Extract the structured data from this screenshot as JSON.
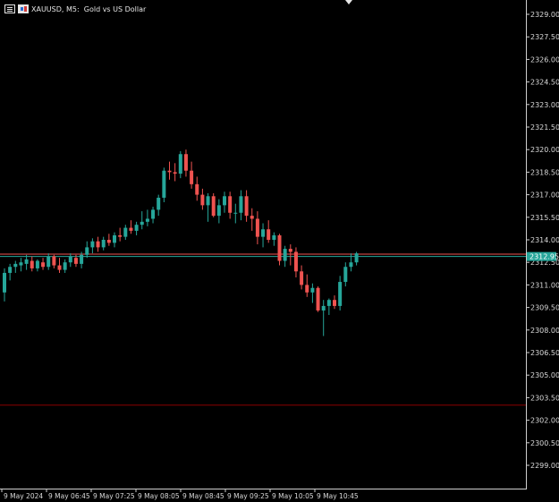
{
  "header": {
    "title": "XAUUSD, M5:  Gold vs US Dollar",
    "menu_icon": "chart-menu-icon",
    "symbol_icon": "symbol-icon"
  },
  "colors": {
    "background": "#000000",
    "bull": "#26a69a",
    "bear": "#ef5350",
    "axis": "#cfcfcf",
    "bid_line": "#26a69a",
    "ask_line": "#ef5350",
    "level_line": "#8b0000",
    "price_tag_bg": "#26a69a"
  },
  "price_scale": {
    "labels": [
      "2329.00",
      "2327.50",
      "2326.00",
      "2324.50",
      "2323.00",
      "2321.50",
      "2320.00",
      "2318.50",
      "2317.00",
      "2315.50",
      "2314.00",
      "2312.50",
      "2311.00",
      "2309.50",
      "2308.00",
      "2306.50",
      "2305.00",
      "2303.50",
      "2302.00",
      "2300.50",
      "2299.00"
    ],
    "current_price": "2312.95"
  },
  "time_scale": {
    "labels": [
      "9 May 2024",
      "9 May 06:45",
      "9 May 07:25",
      "9 May 08:05",
      "9 May 08:45",
      "9 May 09:25",
      "9 May 10:05",
      "9 May 10:45"
    ]
  },
  "levels": {
    "bid": 2312.95,
    "ask": 2313.05,
    "horizontal_line": 2303.0
  },
  "chart_data": {
    "type": "candlestick",
    "symbol": "XAUUSD",
    "timeframe": "M5",
    "ylim": [
      2298.2,
      2329.5
    ],
    "candles": [
      [
        2310.5,
        2312.1,
        2309.9,
        2311.8
      ],
      [
        2311.8,
        2312.4,
        2311.3,
        2312.2
      ],
      [
        2312.2,
        2312.6,
        2311.8,
        2312.4
      ],
      [
        2312.3,
        2312.8,
        2311.9,
        2312.5
      ],
      [
        2312.4,
        2313.0,
        2312.0,
        2312.7
      ],
      [
        2312.6,
        2312.9,
        2311.9,
        2312.1
      ],
      [
        2312.1,
        2312.7,
        2311.9,
        2312.6
      ],
      [
        2312.5,
        2312.8,
        2312.0,
        2312.2
      ],
      [
        2312.2,
        2313.1,
        2312.0,
        2312.9
      ],
      [
        2312.9,
        2313.0,
        2312.1,
        2312.3
      ],
      [
        2312.3,
        2312.8,
        2311.8,
        2312.0
      ],
      [
        2312.0,
        2312.7,
        2311.8,
        2312.5
      ],
      [
        2312.5,
        2313.1,
        2312.2,
        2312.9
      ],
      [
        2312.8,
        2313.0,
        2312.2,
        2312.4
      ],
      [
        2312.4,
        2313.2,
        2312.1,
        2313.0
      ],
      [
        2313.0,
        2313.9,
        2312.8,
        2313.5
      ],
      [
        2313.5,
        2314.1,
        2313.1,
        2313.9
      ],
      [
        2313.9,
        2314.2,
        2313.2,
        2313.5
      ],
      [
        2313.5,
        2314.2,
        2313.3,
        2314.0
      ],
      [
        2314.0,
        2314.4,
        2313.6,
        2313.8
      ],
      [
        2313.8,
        2314.5,
        2313.5,
        2314.3
      ],
      [
        2314.3,
        2314.8,
        2313.9,
        2314.2
      ],
      [
        2314.2,
        2315.0,
        2314.0,
        2314.8
      ],
      [
        2314.8,
        2315.3,
        2314.4,
        2314.6
      ],
      [
        2314.6,
        2315.2,
        2314.3,
        2315.0
      ],
      [
        2315.0,
        2315.9,
        2314.7,
        2315.2
      ],
      [
        2315.2,
        2316.0,
        2314.9,
        2315.4
      ],
      [
        2315.4,
        2316.2,
        2315.1,
        2316.0
      ],
      [
        2316.0,
        2317.0,
        2315.6,
        2316.8
      ],
      [
        2316.8,
        2318.8,
        2316.5,
        2318.6
      ],
      [
        2318.6,
        2319.2,
        2318.0,
        2318.5
      ],
      [
        2318.5,
        2319.1,
        2317.9,
        2318.4
      ],
      [
        2318.4,
        2319.9,
        2318.1,
        2319.7
      ],
      [
        2319.7,
        2320.0,
        2318.2,
        2318.6
      ],
      [
        2318.6,
        2319.2,
        2317.4,
        2317.7
      ],
      [
        2317.7,
        2318.2,
        2316.6,
        2317.0
      ],
      [
        2317.0,
        2317.4,
        2316.0,
        2316.3
      ],
      [
        2316.3,
        2317.1,
        2315.2,
        2316.9
      ],
      [
        2316.9,
        2317.1,
        2315.5,
        2315.6
      ],
      [
        2315.6,
        2316.7,
        2315.1,
        2316.3
      ],
      [
        2316.3,
        2317.2,
        2315.8,
        2316.9
      ],
      [
        2316.9,
        2317.2,
        2315.4,
        2315.8
      ],
      [
        2315.8,
        2316.4,
        2315.1,
        2315.8
      ],
      [
        2315.8,
        2317.3,
        2315.3,
        2316.9
      ],
      [
        2316.9,
        2317.3,
        2315.2,
        2315.6
      ],
      [
        2315.6,
        2316.1,
        2314.6,
        2315.4
      ],
      [
        2315.4,
        2315.9,
        2313.7,
        2314.2
      ],
      [
        2314.2,
        2315.1,
        2313.5,
        2314.7
      ],
      [
        2314.7,
        2315.3,
        2313.8,
        2314.0
      ],
      [
        2314.0,
        2314.5,
        2313.6,
        2314.3
      ],
      [
        2314.3,
        2314.4,
        2312.3,
        2312.6
      ],
      [
        2312.6,
        2313.6,
        2312.2,
        2313.4
      ],
      [
        2313.4,
        2313.7,
        2312.3,
        2313.2
      ],
      [
        2313.2,
        2313.5,
        2311.5,
        2311.9
      ],
      [
        2311.9,
        2312.3,
        2310.7,
        2311.0
      ],
      [
        2311.0,
        2311.7,
        2310.2,
        2310.5
      ],
      [
        2310.5,
        2311.1,
        2309.8,
        2310.8
      ],
      [
        2310.8,
        2310.9,
        2309.2,
        2309.3
      ],
      [
        2309.3,
        2310.0,
        2307.6,
        2309.6
      ],
      [
        2309.6,
        2310.1,
        2309.0,
        2310.0
      ],
      [
        2310.0,
        2310.3,
        2309.4,
        2309.6
      ],
      [
        2309.6,
        2311.6,
        2309.3,
        2311.2
      ],
      [
        2311.2,
        2312.5,
        2310.9,
        2312.2
      ],
      [
        2312.2,
        2313.1,
        2311.9,
        2312.5
      ],
      [
        2312.5,
        2313.2,
        2312.3,
        2313.1
      ]
    ]
  }
}
